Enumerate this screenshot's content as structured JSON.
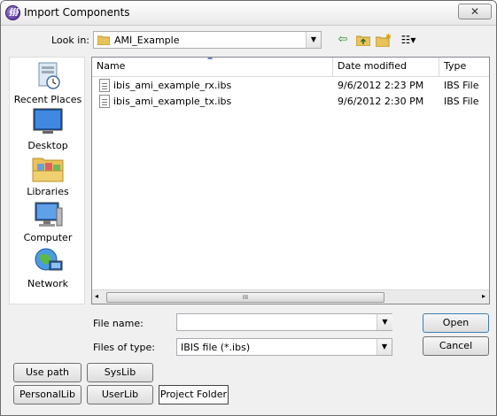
{
  "window": {
    "title": "Import Components",
    "close_glyph": "✕"
  },
  "app_icon_glyph": "∰",
  "lookin": {
    "label": "Look in:",
    "value": "AMI_Example"
  },
  "toolbar": {
    "back_glyph": "⇦",
    "up_glyph": "⇧",
    "new_folder_glyph": "✱",
    "view_glyph": "☷▾"
  },
  "places": [
    {
      "label": "Recent Places",
      "icon": "recent-places-icon"
    },
    {
      "label": "Desktop",
      "icon": "desktop-icon"
    },
    {
      "label": "Libraries",
      "icon": "libraries-icon"
    },
    {
      "label": "Computer",
      "icon": "computer-icon"
    },
    {
      "label": "Network",
      "icon": "network-icon"
    }
  ],
  "columns": {
    "name": "Name",
    "date": "Date modified",
    "type": "Type"
  },
  "files": [
    {
      "name": "ibis_ami_example_rx.ibs",
      "date": "9/6/2012 2:23 PM",
      "type": "IBS File"
    },
    {
      "name": "ibis_ami_example_tx.ibs",
      "date": "9/6/2012 2:30 PM",
      "type": "IBS File"
    }
  ],
  "scroll": {
    "left": "◂",
    "right": "▸",
    "grip": "III"
  },
  "filename": {
    "label": "File name:",
    "value": ""
  },
  "filetype": {
    "label": "Files of type:",
    "value": "IBIS file (*.ibs)"
  },
  "dd_arrow": "▼",
  "buttons": {
    "open": "Open",
    "cancel": "Cancel",
    "use_path": "Use path",
    "syslib": "SysLib",
    "personallib": "PersonalLib",
    "userlib": "UserLib",
    "project_folder": "Project Folder"
  },
  "colors": {
    "accent": "#3c7fb1",
    "folder": "#e8c25a"
  }
}
